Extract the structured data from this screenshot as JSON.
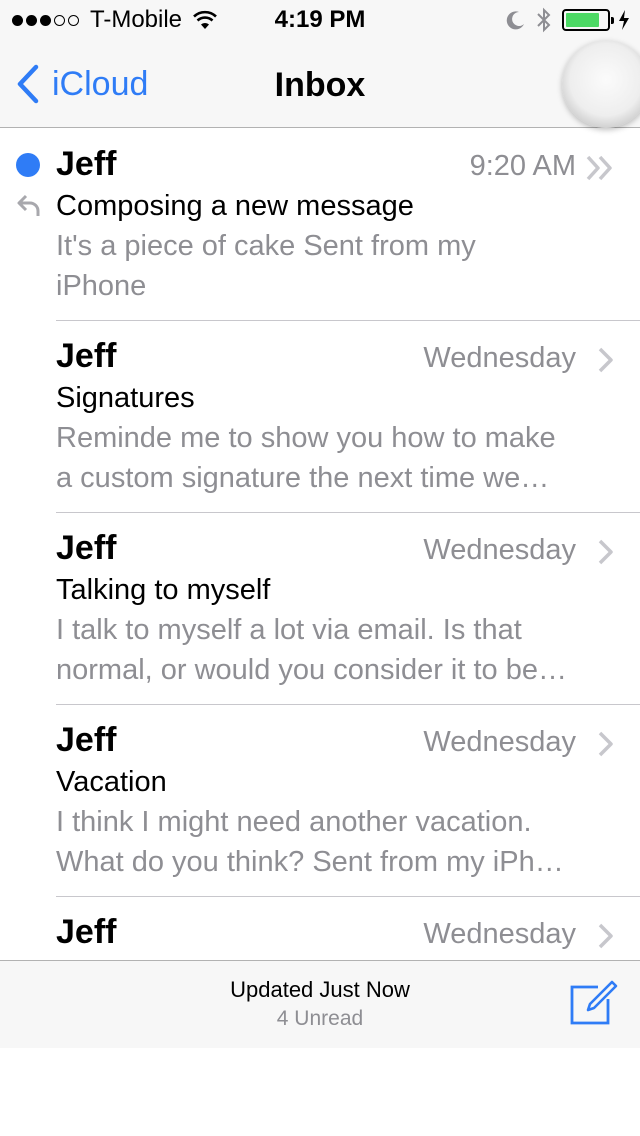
{
  "status_bar": {
    "carrier": "T-Mobile",
    "signal": {
      "filled": 3,
      "empty": 2
    },
    "time": "4:19 PM",
    "battery_color": "#4cd964",
    "icons": [
      "wifi-icon",
      "moon-icon",
      "bluetooth-icon",
      "battery-icon",
      "charging-icon"
    ]
  },
  "nav": {
    "back_label": "iCloud",
    "title": "Inbox"
  },
  "accent_color": "#2f7cf6",
  "messages": [
    {
      "sender": "Jeff",
      "date": "9:20 AM",
      "subject": "Composing a new message",
      "preview": [
        "It's a piece of cake Sent from my",
        "iPhone"
      ],
      "unread": true,
      "replied": true,
      "thread": true
    },
    {
      "sender": "Jeff",
      "date": "Wednesday",
      "subject": "Signatures",
      "preview": [
        "Reminde me to show you how to make",
        "a custom signature the next time we…"
      ],
      "unread": false
    },
    {
      "sender": "Jeff",
      "date": "Wednesday",
      "subject": "Talking to myself",
      "preview": [
        "I talk to myself a lot via email. Is that",
        "normal, or would you consider it to be…"
      ],
      "unread": false
    },
    {
      "sender": "Jeff",
      "date": "Wednesday",
      "subject": "Vacation",
      "preview": [
        "I think I might need another vacation.",
        "What do you think? Sent from my iPh…"
      ],
      "unread": false
    },
    {
      "sender": "Jeff",
      "date": "Wednesday",
      "subject": "",
      "preview": [
        "",
        ""
      ],
      "unread": false
    }
  ],
  "toolbar": {
    "status": "Updated Just Now",
    "unread_count": "4 Unread"
  }
}
